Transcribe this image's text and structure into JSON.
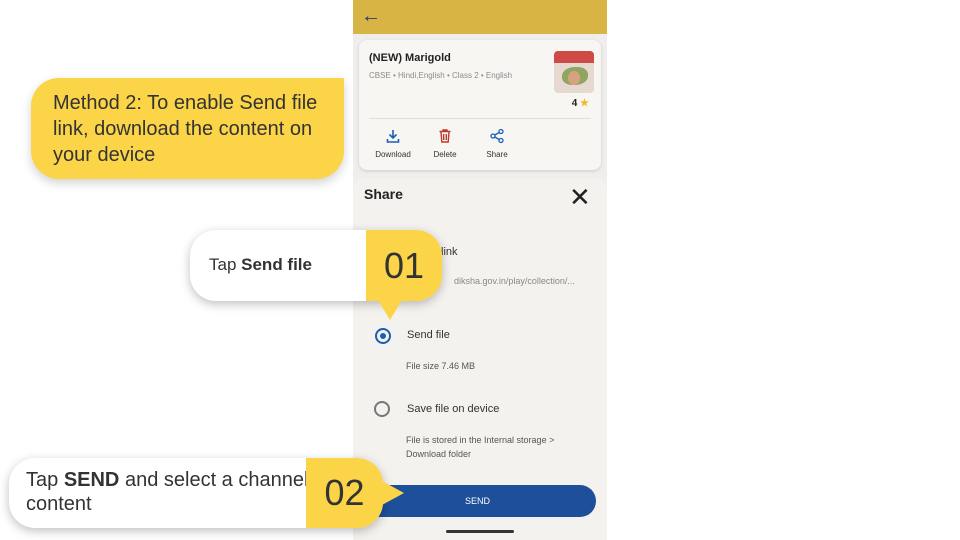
{
  "colors": {
    "accent": "#d8b444",
    "callout_yellow": "#fbd448",
    "primary_blue": "#1e4f9a",
    "delete_red": "#c0392b"
  },
  "content": {
    "title": "(NEW) Marigold",
    "meta": "CBSE • Hindi,English • Class 2 • English",
    "rating": "4",
    "actions": [
      {
        "label": "Download",
        "icon": "download-icon"
      },
      {
        "label": "Delete",
        "icon": "trash-icon"
      },
      {
        "label": "Share",
        "icon": "share-icon"
      }
    ]
  },
  "share": {
    "title": "Share",
    "link_label": "link",
    "link_url": "diksha.gov.in/play/collection/...",
    "send_file_label": "Send file",
    "send_file_selected": true,
    "file_size": "File size 7.46 MB",
    "save_label": "Save file on device",
    "save_note_line1": "File is stored in the Internal storage >",
    "save_note_line2": "Download folder",
    "send_button": "SEND"
  },
  "callouts": {
    "method": "Method 2: To enable Send file link, download the content on your device",
    "step1_prefix": "Tap ",
    "step1_bold": "Send file",
    "step1_num": "01",
    "step2_prefix": "Tap ",
    "step2_bold": "SEND",
    "step2_suffix": " and select a channel to send content",
    "step2_num": "02"
  }
}
